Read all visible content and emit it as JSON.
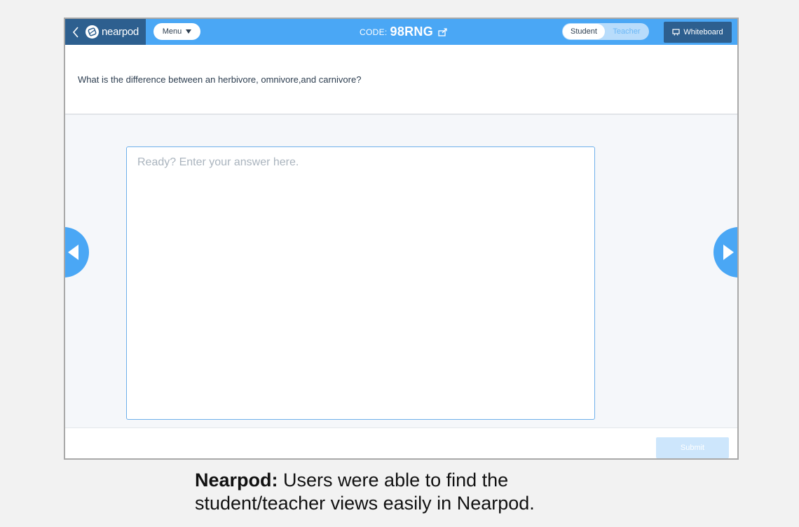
{
  "header": {
    "brand_name": "nearpod",
    "menu_label": "Menu",
    "code_label": "CODE:",
    "code_value": "98RNG",
    "view_toggle": {
      "student_label": "Student",
      "teacher_label": "Teacher",
      "selected": "Student"
    },
    "whiteboard_label": "Whiteboard"
  },
  "question": {
    "text": "What is the difference between an herbivore, omnivore,and carnivore?"
  },
  "answer": {
    "placeholder": "Ready? Enter your answer here.",
    "value": ""
  },
  "footer": {
    "submit_label": "Submit"
  },
  "caption": {
    "bold": "Nearpod:",
    "line1": " Users were able to find the",
    "line2": "student/teacher views easily in Nearpod."
  },
  "colors": {
    "primary_blue": "#4aa7f5",
    "dark_blue": "#2d5f8f",
    "submit_disabled": "#cde6fc"
  },
  "icons": {
    "back": "chevron-left-icon",
    "logo": "nearpod-logo-icon",
    "menu_caret": "caret-down-icon",
    "share": "share-icon",
    "whiteboard": "whiteboard-icon",
    "prev": "arrow-left-icon",
    "next": "arrow-right-icon"
  }
}
